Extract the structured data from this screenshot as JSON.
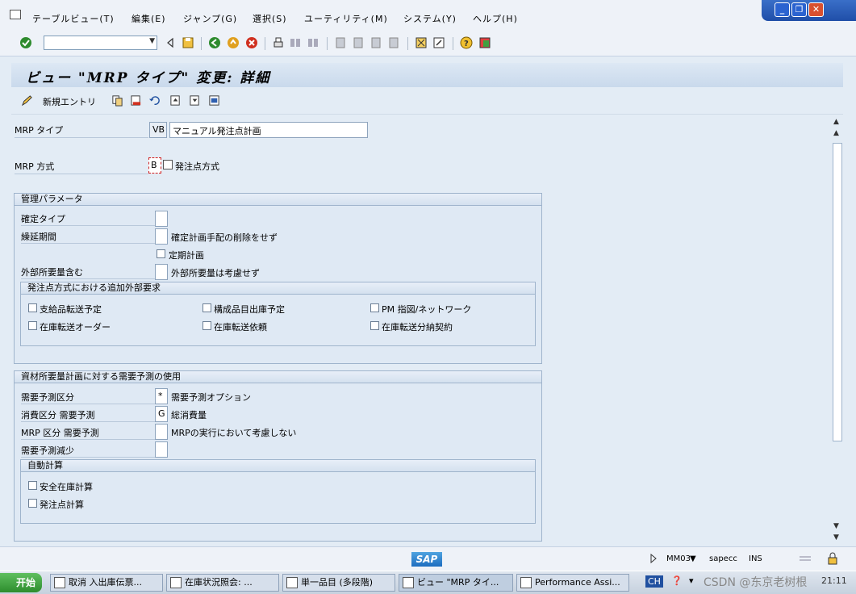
{
  "menubar": {
    "items": [
      "テーブルビュー(T)",
      "編集(E)",
      "ジャンプ(G)",
      "選択(S)",
      "ユーティリティ(M)",
      "システム(Y)",
      "ヘルプ(H)"
    ]
  },
  "title": "ビュー \"MRP タイプ\" 変更: 詳細",
  "apptoolbar": {
    "new_entries": "新規エントリ"
  },
  "fields": {
    "mrp_type_label": "MRP タイプ",
    "mrp_type_value": "VB",
    "mrp_type_desc": "マニュアル発注点計画",
    "mrp_proc_label": "MRP 方式",
    "mrp_proc_value": "B",
    "mrp_proc_desc": "発注点方式"
  },
  "group_control": {
    "title": "管理パラメータ",
    "firm_type_label": "確定タイプ",
    "roll_forward_label": "繰延期間",
    "roll_forward_desc": "確定計画手配の削除をせず",
    "periodic_label": "定期計画",
    "ext_req_label": "外部所要量含む",
    "ext_req_desc": "外部所要量は考慮せず",
    "sub_title": "発注点方式における追加外部要求",
    "checks": [
      "支給品転送予定",
      "構成品目出庫予定",
      "PM 指図/ネットワーク",
      "在庫転送オーダー",
      "在庫転送依頼",
      "在庫転送分納契約"
    ]
  },
  "group_forecast": {
    "title": "資材所要量計画に対する需要予測の使用",
    "fc_ind_label": "需要予測区分",
    "fc_ind_value": "*",
    "fc_ind_desc": "需要予測オプション",
    "cons_ind_label": "消費区分 需要予測",
    "cons_ind_value": "G",
    "cons_ind_desc": "総消費量",
    "mrp_fc_label": "MRP 区分 需要予測",
    "mrp_fc_desc": "MRPの実行において考慮しない",
    "fc_reduce_label": "需要予測減少",
    "auto_title": "自動計算",
    "auto_checks": [
      "安全在庫計算",
      "発注点計算"
    ]
  },
  "statusbar": {
    "tcode": "MM03",
    "system": "sapecc",
    "mode": "INS"
  },
  "taskbar": {
    "start": "开始",
    "tasks": [
      "取消 入出庫伝票...",
      "在庫状況照会: ...",
      "単一品目 (多段階)",
      "ビュー \"MRP タイ...",
      "Performance Assi..."
    ],
    "lang": "CH",
    "watermark": "CSDN @东京老树根",
    "time": "21:11"
  }
}
